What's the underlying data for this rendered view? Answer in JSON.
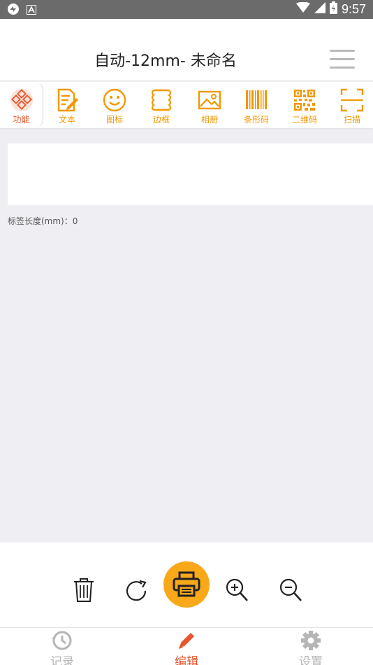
{
  "status_bar": {
    "time": "9:57"
  },
  "header": {
    "title": "自动-12mm- 未命名"
  },
  "toolbar": [
    {
      "label": "功能",
      "icon": "function-icon"
    },
    {
      "label": "文本",
      "icon": "text-edit-icon"
    },
    {
      "label": "图标",
      "icon": "smiley-icon"
    },
    {
      "label": "边框",
      "icon": "border-frame-icon"
    },
    {
      "label": "相册",
      "icon": "photo-icon"
    },
    {
      "label": "条形码",
      "icon": "barcode-icon"
    },
    {
      "label": "二维码",
      "icon": "qrcode-icon"
    },
    {
      "label": "扫描",
      "icon": "scan-icon"
    }
  ],
  "label_info": {
    "length_text": "标签长度(mm)：0"
  },
  "bottom_nav": [
    {
      "label": "记录",
      "icon": "history-icon"
    },
    {
      "label": "编辑",
      "icon": "edit-pencil-icon"
    },
    {
      "label": "设置",
      "icon": "settings-gear-icon"
    }
  ],
  "colors": {
    "accent": "#f39800",
    "active": "#e8542b",
    "print_button": "#f9a81a"
  }
}
